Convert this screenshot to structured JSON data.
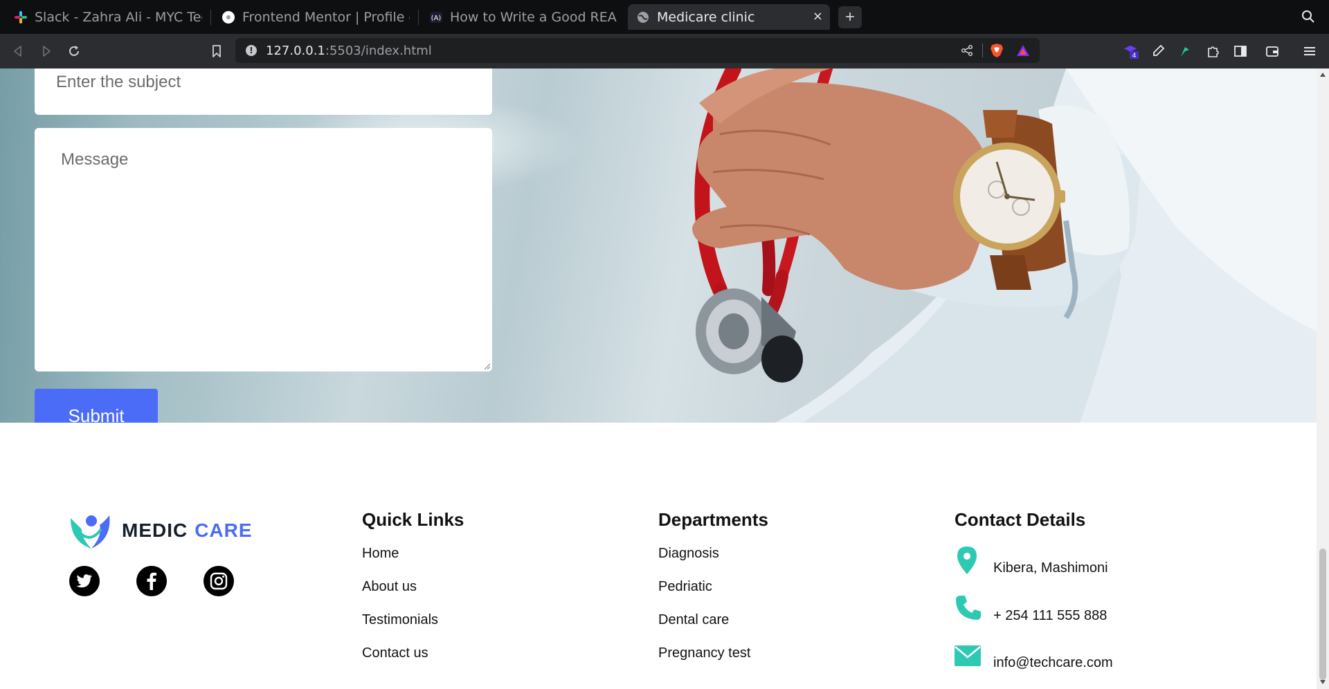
{
  "browser": {
    "tabs": [
      {
        "title": "Slack - Zahra Ali - MYC Tech A",
        "icon": "slack-icon"
      },
      {
        "title": "Frontend Mentor | Profile ca",
        "icon": "frontend-mentor-icon"
      },
      {
        "title": "How to Write a Good READM",
        "icon": "freecodecamp-icon"
      },
      {
        "title": "Medicare clinic",
        "icon": "globe-icon"
      }
    ],
    "new_tab": "+",
    "close": "×",
    "url_host": "127.0.0.1",
    "url_rest": ":5503/index.html",
    "extension_badge": "4"
  },
  "form": {
    "subject_placeholder": "Enter the subject",
    "message_placeholder": "Message",
    "submit_label": "Submit"
  },
  "footer": {
    "logo": {
      "word1": "MEDIC",
      "word2": "CARE"
    },
    "social": [
      "twitter-icon",
      "facebook-icon",
      "instagram-icon"
    ],
    "quick_links": {
      "title": "Quick Links",
      "items": [
        "Home",
        "About us",
        "Testimonials",
        "Contact us"
      ]
    },
    "departments": {
      "title": "Departments",
      "items": [
        "Diagnosis",
        "Pedriatic",
        "Dental care",
        "Pregnancy test"
      ]
    },
    "contact": {
      "title": "Contact Details",
      "address": "Kibera, Mashimoni",
      "phone": "+ 254 111 555 888",
      "email": "info@techcare.com"
    }
  },
  "colors": {
    "accent": "#4a6cf7",
    "contact_icon": "#2ec9b3",
    "logo_teal": "#2ec9b3"
  }
}
